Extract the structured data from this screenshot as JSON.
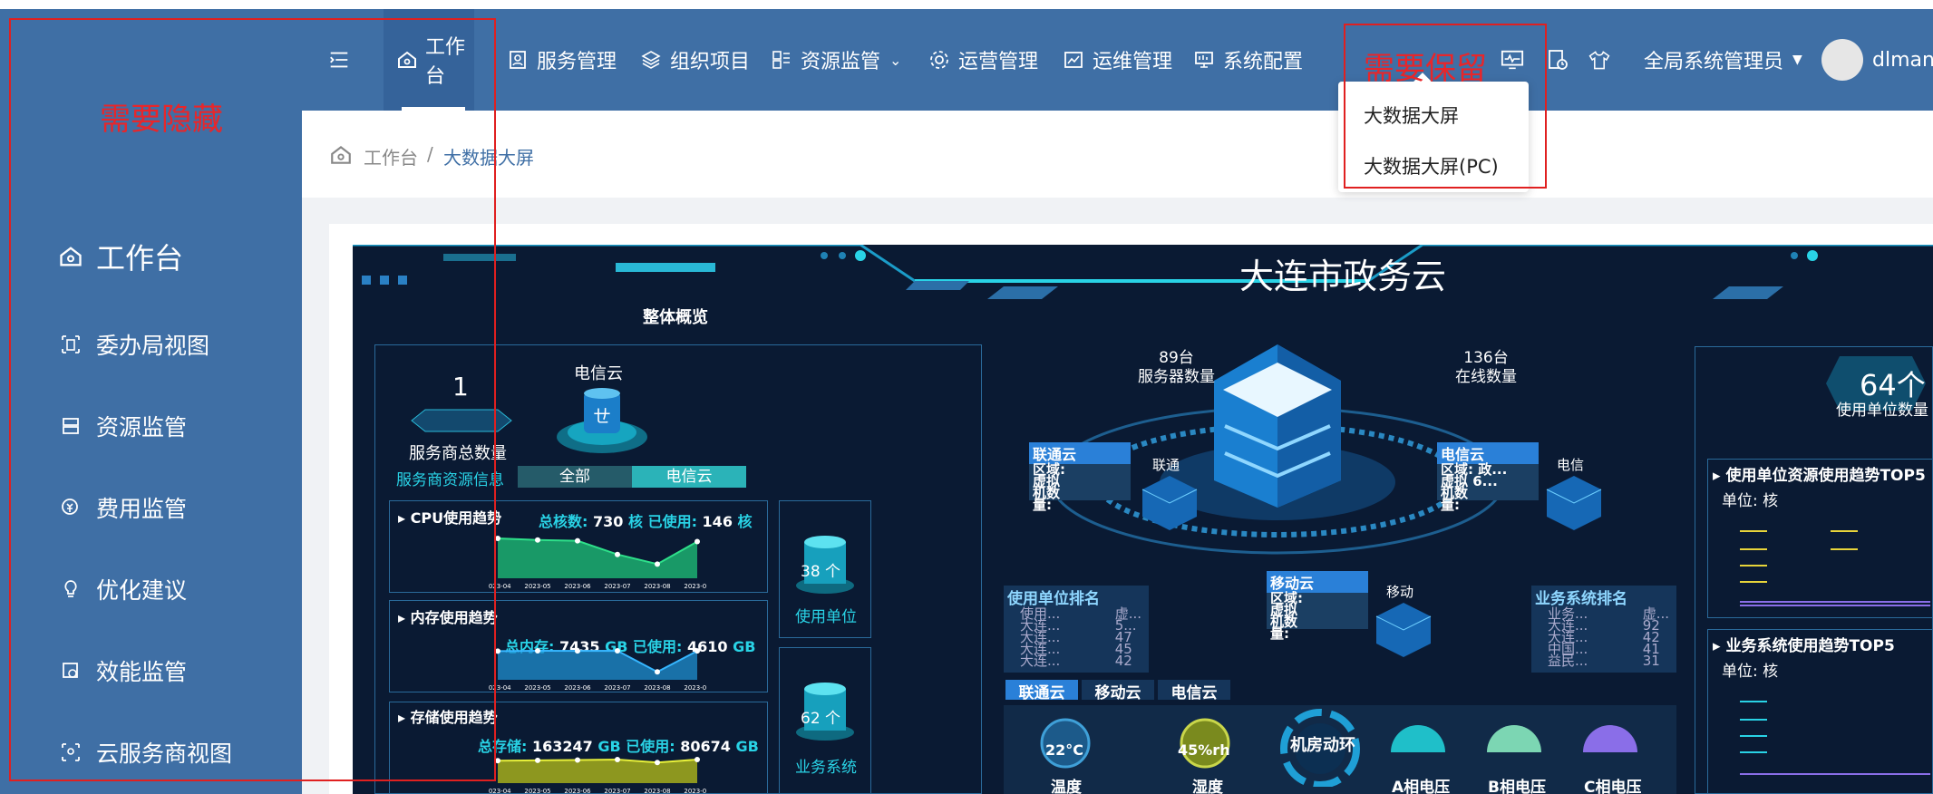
{
  "annotations": {
    "hide": "需要隐藏",
    "keep": "需要保留"
  },
  "sidebar": {
    "items": [
      {
        "label": "工作台",
        "icon": "home-icon"
      },
      {
        "label": "委办局视图",
        "icon": "building-icon"
      },
      {
        "label": "资源监管",
        "icon": "server-icon"
      },
      {
        "label": "费用监管",
        "icon": "cost-icon"
      },
      {
        "label": "优化建议",
        "icon": "bulb-icon"
      },
      {
        "label": "效能监管",
        "icon": "gauge-icon"
      },
      {
        "label": "云服务商视图",
        "icon": "cloud-icon"
      }
    ]
  },
  "nav": {
    "items": [
      {
        "label": "工作台",
        "icon": "home-icon"
      },
      {
        "label": "服务管理",
        "icon": "user-card-icon"
      },
      {
        "label": "组织项目",
        "icon": "layers-icon"
      },
      {
        "label": "资源监管",
        "icon": "grid-icon"
      },
      {
        "label": "运营管理",
        "icon": "settings-icon"
      },
      {
        "label": "运维管理",
        "icon": "chart-icon"
      },
      {
        "label": "系统配置",
        "icon": "monitor-icon"
      }
    ],
    "user": "全局系统管理员",
    "account": "dlmanag"
  },
  "dropdown": {
    "items": [
      "大数据大屏",
      "大数据大屏(PC)"
    ]
  },
  "breadcrumb": {
    "home": "工作台",
    "sep": "/",
    "current": "大数据大屏"
  },
  "screen": {
    "title": "大连市政务云",
    "overview": "整体概览",
    "provider_count": "1",
    "provider_count_label": "服务商总数量",
    "telecom_label": "电信云",
    "provider_info": "服务商资源信息",
    "tabs": [
      "全部",
      "电信云"
    ],
    "cpu": {
      "title": "CPU使用趋势",
      "summary_label": "总核数:",
      "total": "730",
      "unit": "核",
      "used_label": "已使用:",
      "used": "146",
      "unit2": "核"
    },
    "mem": {
      "title": "内存使用趋势",
      "summary_label": "总内存:",
      "total": "7435",
      "unit": "GB",
      "used_label": "已使用:",
      "used": "4610",
      "unit2": "GB"
    },
    "storage": {
      "title": "存储使用趋势",
      "summary_label": "总存储:",
      "total": "163247",
      "unit": "GB",
      "used_label": "已使用:",
      "used": "80674",
      "unit2": "GB"
    },
    "dates": [
      "2023-04",
      "2023-05",
      "2023-06",
      "2023-07",
      "2023-08",
      "2023-09"
    ],
    "units_count": "38 个",
    "units_label": "使用单位",
    "sys_count": "62 个",
    "sys_label": "业务系统",
    "servers": {
      "value": "89台",
      "label": "服务器数量"
    },
    "online": {
      "value": "136台",
      "label": "在线数量"
    },
    "unicom": {
      "name": "联通云",
      "tag": "联通",
      "l1": "区域:",
      "l2": "虚拟",
      "l3": "机数",
      "l4": "量:"
    },
    "telecom": {
      "name": "电信云",
      "tag": "电信",
      "l1": "区域:",
      "v1": "政...",
      "l2": "虚拟",
      "v2": "6...",
      "l3": "机数",
      "l4": "量:"
    },
    "mobile": {
      "name": "移动云",
      "tag": "移动",
      "l1": "区域:",
      "l2": "虚拟",
      "l3": "机数",
      "l4": "量:"
    },
    "unit_rank": {
      "title": "使用单位排名",
      "rows": [
        "使用...",
        "大连...",
        "大连...",
        "大连...",
        "大连..."
      ],
      "vals": [
        "虚...",
        "5...",
        "47",
        "45",
        "42"
      ]
    },
    "sys_rank": {
      "title": "业务系统排名",
      "rows": [
        "业务...",
        "大连...",
        "大连...",
        "中国...",
        "益民..."
      ],
      "vals": [
        "虚...",
        "92",
        "42",
        "41",
        "31"
      ]
    },
    "cloud_tabs": [
      "联通云",
      "移动云",
      "电信云"
    ],
    "env": {
      "temp": "22°C",
      "temp_label": "温度",
      "hum": "45%rh",
      "hum_label": "湿度",
      "room": "机房动环",
      "a": "A相电压",
      "b": "B相电压",
      "c": "C相电压"
    },
    "right": {
      "count": "64个",
      "count_label": "使用单位数量",
      "trend1": "使用单位资源使用趋势TOP5",
      "unit1": "单位: 核",
      "trend2": "业务系统使用趋势TOP5",
      "unit2": "单位: 核"
    }
  },
  "colors": {
    "nav": "#3f6fa5",
    "screen_bg": "#0a1a33",
    "accent": "#29d3e6",
    "annotation": "#e8262a"
  },
  "chart_data": [
    {
      "type": "area",
      "title": "CPU使用趋势",
      "x": [
        "2023-04",
        "2023-05",
        "2023-06",
        "2023-07",
        "2023-08",
        "2023-09"
      ],
      "values": [
        150,
        148,
        147,
        130,
        118,
        146
      ]
    },
    {
      "type": "area",
      "title": "内存使用趋势",
      "x": [
        "2023-04",
        "2023-05",
        "2023-06",
        "2023-07",
        "2023-08",
        "2023-09"
      ],
      "values": [
        4600,
        4620,
        4610,
        4620,
        3300,
        4610
      ]
    },
    {
      "type": "area",
      "title": "存储使用趋势",
      "x": [
        "2023-04",
        "2023-05",
        "2023-06",
        "2023-07",
        "2023-08",
        "2023-09"
      ],
      "values": [
        80000,
        80200,
        80400,
        80674,
        79000,
        80674
      ]
    }
  ]
}
